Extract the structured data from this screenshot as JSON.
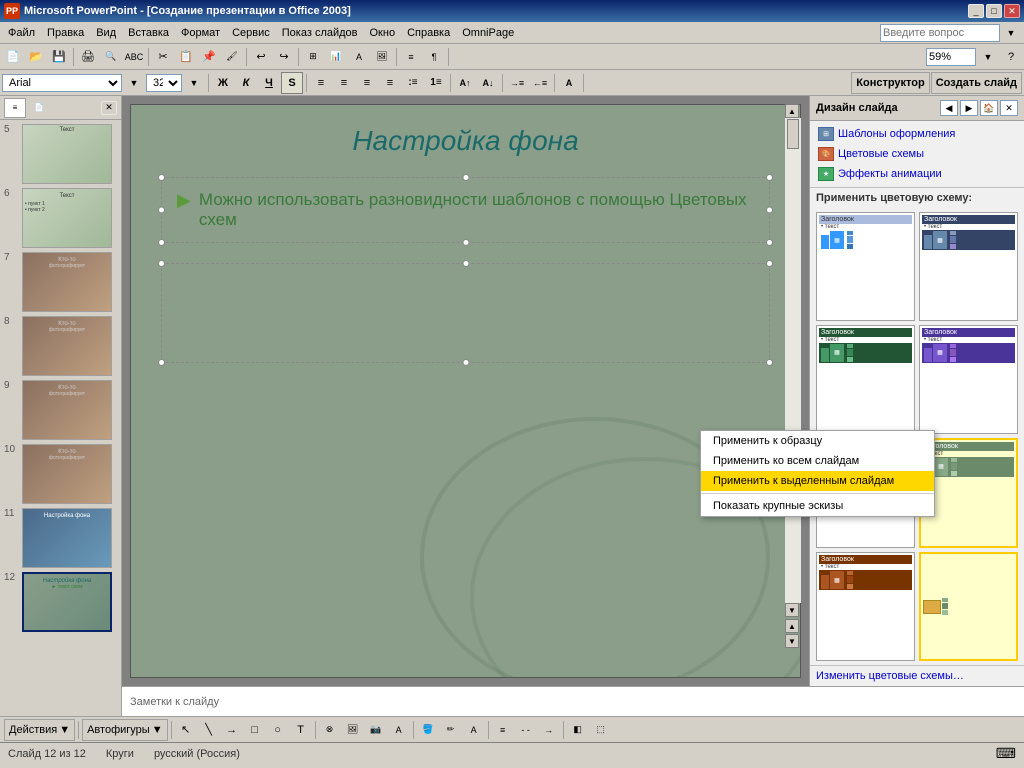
{
  "titleBar": {
    "title": "Microsoft PowerPoint - [Создание презентации в Office 2003]",
    "appIcon": "PP",
    "buttons": [
      "_",
      "□",
      "✕"
    ]
  },
  "menuBar": {
    "items": [
      "Файл",
      "Правка",
      "Вид",
      "Вставка",
      "Формат",
      "Сервис",
      "Показ слайдов",
      "Окно",
      "Справка",
      "OmniPage"
    ]
  },
  "toolbar": {
    "zoom": "59%",
    "searchPlaceholder": "Введите вопрос"
  },
  "formatToolbar": {
    "font": "Arial",
    "size": "32",
    "designerBtn": "Конструктор",
    "createSlideBtn": "Создать слайд"
  },
  "slidePanel": {
    "slides": [
      {
        "num": "5",
        "class": "thumb-5",
        "text": "Текст"
      },
      {
        "num": "6",
        "class": "thumb-6",
        "text": "Текст"
      },
      {
        "num": "7",
        "class": "thumb-7",
        "text": "Кто-то фотографирует"
      },
      {
        "num": "8",
        "class": "thumb-8",
        "text": "Кто-то фотографирует"
      },
      {
        "num": "9",
        "class": "thumb-9",
        "text": "Кто-то фотографирует"
      },
      {
        "num": "10",
        "class": "thumb-10",
        "text": "Кто-то фотографирует"
      },
      {
        "num": "11",
        "class": "thumb-11",
        "text": "Настройка фона"
      },
      {
        "num": "12",
        "class": "thumb-12",
        "text": "Настройка фона",
        "active": true
      }
    ]
  },
  "slide": {
    "title": "Настройка фона",
    "bulletText": "Можно использовать разновидности шаблонов с помощью Цветовых схем"
  },
  "notesBar": {
    "placeholder": "Заметки к слайду"
  },
  "designPanel": {
    "title": "Дизайн слайда",
    "navButtons": [
      "◀",
      "▶",
      "🏠"
    ],
    "tabs": [
      {
        "label": "Шаблоны оформления"
      },
      {
        "label": "Цветовые схемы"
      },
      {
        "label": "Эффекты анимации"
      }
    ],
    "sectionLabel": "Применить цветовую схему:",
    "schemes": [
      {
        "id": 1,
        "headerText": "Заголовок",
        "subText": "• текст",
        "color1": "#4a6a9a",
        "color2": "#88aacc"
      },
      {
        "id": 2,
        "headerText": "Заголовок",
        "subText": "• текст",
        "color1": "#334466",
        "color2": "#6688aa"
      },
      {
        "id": 3,
        "headerText": "Заголовок",
        "subText": "• текст",
        "color1": "#225533",
        "color2": "#449966"
      },
      {
        "id": 4,
        "headerText": "Заголовок",
        "subText": "• текст",
        "color1": "#4a3399",
        "color2": "#7755cc"
      },
      {
        "id": 5,
        "headerText": "Заголовок",
        "subText": "• текст",
        "color1": "#336699",
        "color2": "#5588bb"
      },
      {
        "id": 6,
        "headerText": "Заголовок",
        "subText": "• текст",
        "active": true,
        "color1": "#6a8a6a",
        "color2": "#88aa88"
      },
      {
        "id": 7,
        "headerText": "Заголовок",
        "subText": "• текст",
        "color1": "#773300",
        "color2": "#aa5522"
      }
    ],
    "bottomLink": "Изменить цветовые схемы…"
  },
  "contextMenu": {
    "items": [
      {
        "label": "Применить к образцу",
        "highlighted": false
      },
      {
        "label": "Применить ко всем слайдам",
        "highlighted": false
      },
      {
        "label": "Применить к выделенным слайдам",
        "highlighted": true
      },
      {
        "label": "Показать крупные эскизы",
        "highlighted": false
      }
    ]
  },
  "bottomToolbar": {
    "actions": "Действия",
    "autoshapes": "Автофигуры"
  },
  "statusBar": {
    "slideInfo": "Слайд 12 из 12",
    "shape": "Круги",
    "language": "русский (Россия)"
  }
}
